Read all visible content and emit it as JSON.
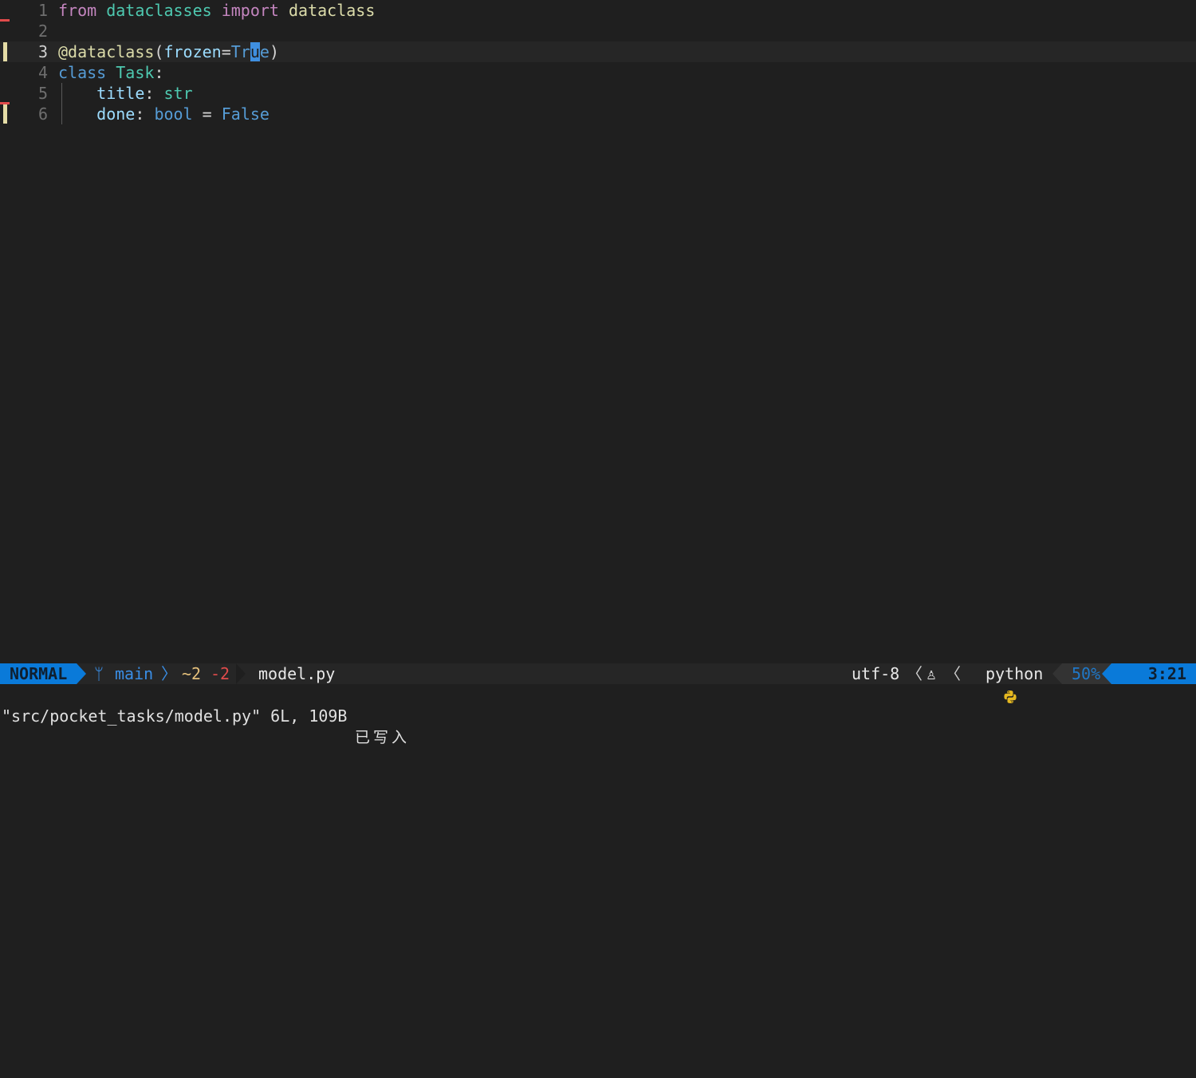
{
  "editor": {
    "lines": [
      {
        "num": "1",
        "tokens": [
          {
            "t": "from",
            "c": "kw"
          },
          {
            "t": " "
          },
          {
            "t": "dataclasses",
            "c": "mod"
          },
          {
            "t": " "
          },
          {
            "t": "import",
            "c": "kw"
          },
          {
            "t": " "
          },
          {
            "t": "dataclass",
            "c": "fn"
          }
        ]
      },
      {
        "num": "2",
        "tokens": []
      },
      {
        "num": "3",
        "tokens": [
          {
            "t": "@dataclass",
            "c": "deco"
          },
          {
            "t": "(",
            "c": "op"
          },
          {
            "t": "frozen",
            "c": "var"
          },
          {
            "t": "=",
            "c": "op"
          },
          {
            "t": "Tr",
            "c": "const"
          },
          {
            "t": "u",
            "c": "cursor"
          },
          {
            "t": "e",
            "c": "const"
          },
          {
            "t": ")",
            "c": "op"
          }
        ]
      },
      {
        "num": "4",
        "tokens": [
          {
            "t": "class",
            "c": "cls"
          },
          {
            "t": " "
          },
          {
            "t": "Task",
            "c": "type"
          },
          {
            "t": ":",
            "c": "op"
          }
        ]
      },
      {
        "num": "5",
        "tokens": [
          {
            "t": "    "
          },
          {
            "t": "title",
            "c": "var"
          },
          {
            "t": ": ",
            "c": "op"
          },
          {
            "t": "str",
            "c": "type"
          }
        ]
      },
      {
        "num": "6",
        "tokens": [
          {
            "t": "    "
          },
          {
            "t": "done",
            "c": "var"
          },
          {
            "t": ": ",
            "c": "op"
          },
          {
            "t": "bool",
            "c": "const"
          },
          {
            "t": " = ",
            "c": "op"
          },
          {
            "t": "False",
            "c": "const"
          }
        ]
      }
    ],
    "current_line": "3",
    "git_added_lines": [
      "3",
      "6"
    ],
    "git_deleted_lines": [
      "1",
      "5"
    ]
  },
  "statusline": {
    "mode": "NORMAL",
    "branch_icon": "branch-icon",
    "branch": "main",
    "sep": "〉",
    "diff_modified": "~2",
    "diff_deleted": "-2",
    "filename": "model.py",
    "encoding": "utf-8",
    "right_sep": "〈",
    "os_icon": "linux-icon",
    "os_glyph": "♙",
    "filetype_icon": "python-icon",
    "filetype": "python",
    "percent": "50%",
    "position": "3:21"
  },
  "cmdline": {
    "message": "\"src/pocket_tasks/model.py\" 6L, 109B",
    "written": "已写入"
  },
  "colors": {
    "background": "#1f1f1f",
    "mode_bg": "#0a7ad9",
    "git_added": "#e5dca6",
    "git_deleted": "#e14b4b"
  }
}
